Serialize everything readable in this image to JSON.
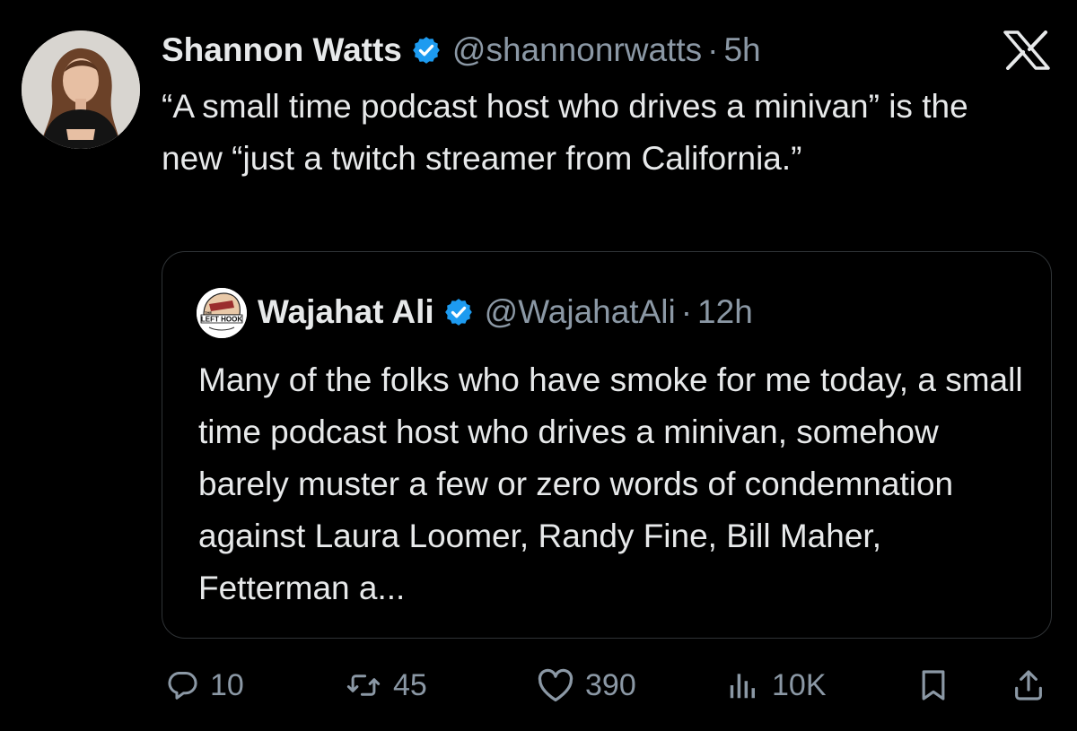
{
  "tweet": {
    "author_name": "Shannon Watts",
    "author_handle": "@shannonrwatts",
    "separator": "·",
    "time": "5h",
    "text": "“A small time podcast host who drives a minivan” is the new “just a twitch streamer from California.”"
  },
  "quote": {
    "author_name": "Wajahat Ali",
    "author_handle": "@WajahatAli",
    "separator": "·",
    "time": "12h",
    "avatar_text_top": "THE",
    "avatar_text": "LEFT HOOK",
    "text": "Many of the folks who have smoke for me today, a small time podcast host who drives a minivan, somehow barely muster a few or zero words of condemnation against Laura Loomer, Randy Fine, Bill Maher, Fetterman a..."
  },
  "actions": {
    "replies": "10",
    "reposts": "45",
    "likes": "390",
    "views": "10K"
  },
  "icons": {
    "verified": "verified-badge-icon",
    "logo": "x-logo-icon",
    "reply": "reply-icon",
    "repost": "repost-icon",
    "like": "heart-icon",
    "views": "views-icon",
    "bookmark": "bookmark-icon",
    "share": "share-icon"
  },
  "colors": {
    "background": "#000000",
    "text": "#e7e9ea",
    "muted": "#8b98a5",
    "verified": "#1d9bf0",
    "border": "#2f3336"
  }
}
